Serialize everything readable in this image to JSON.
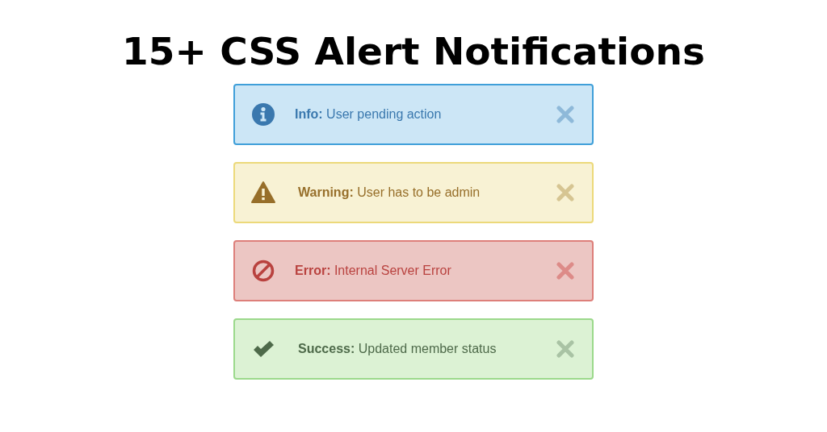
{
  "title": "15+ CSS Alert Notifications",
  "alerts": [
    {
      "kind": "info",
      "message": "**Info:** User pending action"
    },
    {
      "kind": "warning",
      "message": "**Warning:** User has to be admin"
    },
    {
      "kind": "error",
      "message": "**Error:** Internal Server Error"
    },
    {
      "kind": "success",
      "message": "**Success:** Updated member status"
    }
  ]
}
